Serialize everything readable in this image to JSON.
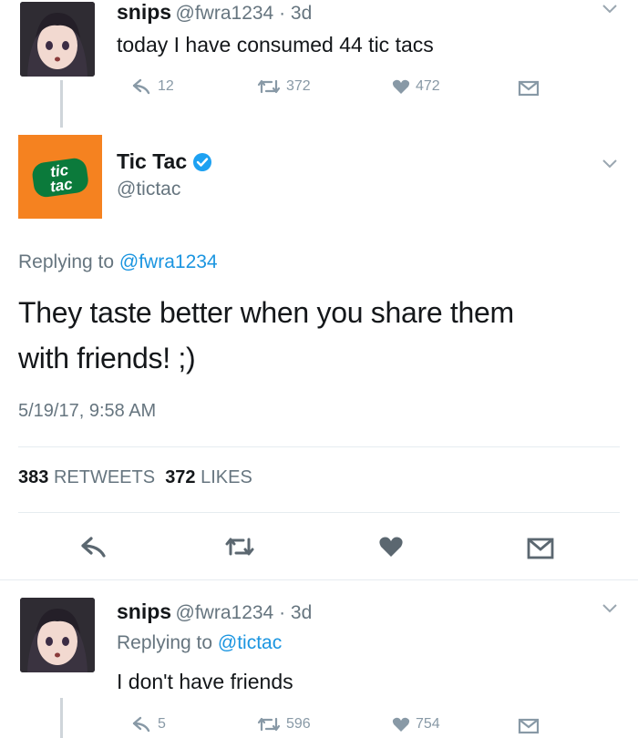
{
  "tweet1": {
    "name": "snips",
    "handle_time": "@fwra1234 · 3d",
    "text": "today I have consumed 44 tic tacs",
    "reply_count": "12",
    "retweet_count": "372",
    "like_count": "472"
  },
  "tweet2": {
    "name": "Tic Tac",
    "handle": "@tictac",
    "logo_text_top": "tic",
    "logo_text_bottom": "tac",
    "replying_prefix": "Replying to ",
    "replying_to": "@fwra1234",
    "text_line1": "They taste better when you share them",
    "text_line2": "with friends! ;)",
    "timestamp": "5/19/17, 9:58 AM",
    "retweets_num": "383",
    "retweets_label": "RETWEETS",
    "likes_num": "372",
    "likes_label": "LIKES"
  },
  "tweet3": {
    "name": "snips",
    "handle_time": "@fwra1234 · 3d",
    "replying_prefix": "Replying to ",
    "replying_to": "@tictac",
    "text": "I don't have friends",
    "reply_count": "5",
    "retweet_count": "596",
    "like_count": "754"
  },
  "icons": {
    "reply": "reply-icon",
    "retweet": "retweet-icon",
    "like": "heart-icon",
    "message": "envelope-icon",
    "more": "chevron-down-icon",
    "verified": "verified-badge-icon"
  },
  "colors": {
    "link_blue": "#1b95e0",
    "verified_blue": "#1da1f2",
    "brand_orange": "#f58220",
    "brand_green": "#0b7a3b"
  }
}
